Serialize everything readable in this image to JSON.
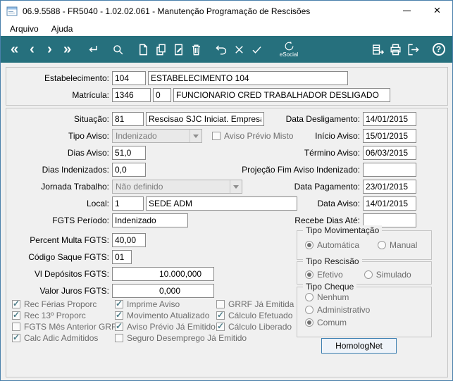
{
  "window": {
    "title": "06.9.5588 - FR5040 - 1.02.02.061 - Manutenção Programação de Rescisões"
  },
  "menu": {
    "items": [
      {
        "label": "Arquivo"
      },
      {
        "label": "Ajuda"
      }
    ]
  },
  "toolbar": {
    "esocial_label": "eSocial",
    "accent_color": "#26707d"
  },
  "top": {
    "estabelecimento": {
      "label": "Estabelecimento:",
      "code": "104",
      "name": "ESTABELECIMENTO 104"
    },
    "matricula": {
      "label": "Matrícula:",
      "code": "1346",
      "seq": "0",
      "name": "FUNCIONARIO CRED TRABALHADOR DESLIGADO"
    }
  },
  "left": {
    "situacao": {
      "label": "Situação:",
      "code": "81",
      "desc": "Rescisao SJC Iniciat. Empresa"
    },
    "tipo_aviso": {
      "label": "Tipo Aviso:",
      "value": "Indenizado",
      "misto_label": "Aviso Prévio Misto",
      "misto_checked": false
    },
    "dias_aviso": {
      "label": "Dias Aviso:",
      "value": "51,0"
    },
    "dias_indenizados": {
      "label": "Dias Indenizados:",
      "value": "0,0"
    },
    "jornada": {
      "label": "Jornada Trabalho:",
      "value": "Não definido"
    },
    "local": {
      "label": "Local:",
      "code": "1",
      "desc": "SEDE ADM"
    },
    "fgts_periodo": {
      "label": "FGTS Período:",
      "value": "Indenizado"
    },
    "percent_multa": {
      "label": "Percent Multa FGTS:",
      "value": "40,00"
    },
    "codigo_saque": {
      "label": "Código Saque FGTS:",
      "value": "01"
    },
    "vl_depositos": {
      "label": "Vl Depósitos FGTS:",
      "value": "10.000,000"
    },
    "valor_juros": {
      "label": "Valor Juros FGTS:",
      "value": "0,000"
    }
  },
  "right": {
    "data_desligamento": {
      "label": "Data Desligamento:",
      "value": "14/01/2015"
    },
    "inicio_aviso": {
      "label": "Início Aviso:",
      "value": "15/01/2015"
    },
    "termino_aviso": {
      "label": "Término Aviso:",
      "value": "06/03/2015"
    },
    "projecao": {
      "label": "Projeção Fim Aviso Indenizado:",
      "value": ""
    },
    "data_pagamento": {
      "label": "Data Pagamento:",
      "value": "23/01/2015"
    },
    "data_aviso": {
      "label": "Data Aviso:",
      "value": "14/01/2015"
    },
    "recebe_dias": {
      "label": "Recebe Dias Até:",
      "value": ""
    }
  },
  "groups": {
    "tipo_movimentacao": {
      "title": "Tipo Movimentação",
      "options": [
        {
          "label": "Automática",
          "selected": true
        },
        {
          "label": "Manual",
          "selected": false
        }
      ]
    },
    "tipo_rescisao": {
      "title": "Tipo Rescisão",
      "options": [
        {
          "label": "Efetivo",
          "selected": true
        },
        {
          "label": "Simulado",
          "selected": false
        }
      ]
    },
    "tipo_cheque": {
      "title": "Tipo Cheque",
      "options": [
        {
          "label": "Nenhum",
          "selected": false
        },
        {
          "label": "Administrativo",
          "selected": false
        },
        {
          "label": "Comum",
          "selected": true
        }
      ]
    }
  },
  "checkboxes": {
    "col1": [
      {
        "label": "Rec Férias Proporc",
        "checked": true
      },
      {
        "label": "Rec 13º Proporc",
        "checked": true
      },
      {
        "label": "FGTS Mês Anterior GRRF",
        "checked": false
      },
      {
        "label": "Calc Adic Admitidos",
        "checked": true
      }
    ],
    "col2": [
      {
        "label": "Imprime Aviso",
        "checked": true
      },
      {
        "label": "Movimento Atualizado",
        "checked": true
      },
      {
        "label": "Aviso Prévio Já Emitido",
        "checked": true
      },
      {
        "label": "Seguro Desemprego Já Emitido",
        "checked": false
      }
    ],
    "col3": [
      {
        "label": "GRRF Já Emitida",
        "checked": false
      },
      {
        "label": "Cálculo Efetuado",
        "checked": true
      },
      {
        "label": "Cálculo Liberado",
        "checked": true
      }
    ]
  },
  "buttons": {
    "homolognet": "HomologNet"
  }
}
